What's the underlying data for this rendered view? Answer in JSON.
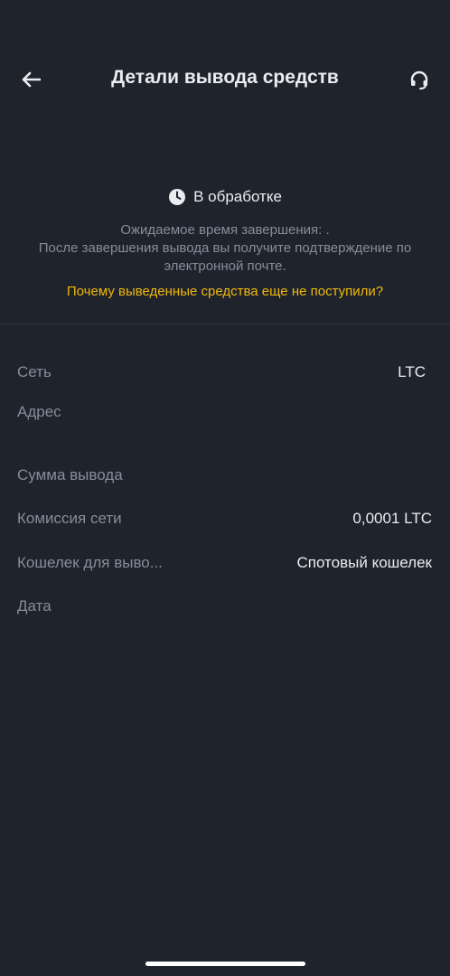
{
  "header": {
    "title": "Детали вывода средств"
  },
  "status": {
    "label": "В обработке",
    "expected_time": "Ожидаемое время завершения: .",
    "confirmation_note": "После завершения вывода вы получите подтверждение по электронной почте.",
    "why_link": "Почему выведенные средства еще не поступили?"
  },
  "details": {
    "network": {
      "label": "Сеть",
      "value": "LTC"
    },
    "address": {
      "label": "Адрес",
      "value": ""
    },
    "amount": {
      "label": "Сумма вывода",
      "value": ""
    },
    "fee": {
      "label": "Комиссия сети",
      "value": "0,0001 LTC"
    },
    "wallet": {
      "label": "Кошелек для выво...",
      "value": "Спотовый кошелек"
    },
    "date": {
      "label": "Дата",
      "value": ""
    }
  },
  "colors": {
    "background": "#1f232c",
    "accent": "#f0b90b",
    "muted_text": "#848e9c",
    "primary_text": "#eaecef"
  }
}
